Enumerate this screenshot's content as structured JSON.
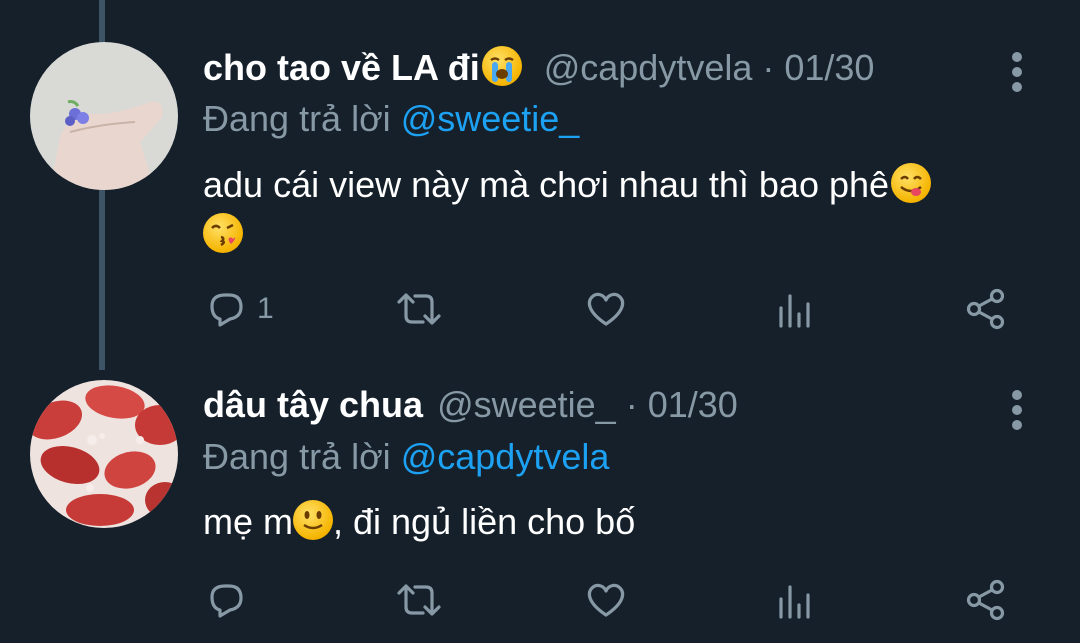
{
  "tweets": [
    {
      "name": "cho tao về LA đi",
      "name_emoji": "loudly-crying-face",
      "handle": "@capdytvela · 01/30",
      "reply_prefix": "Đang trả lời",
      "reply_mention": "@sweetie_",
      "text": "adu cái view này mà chơi nhau thì bao phê",
      "text_emojis": [
        "face-savoring-food",
        "face-blowing-kiss"
      ],
      "reply_count": "1"
    },
    {
      "name": "dâu tây chua",
      "handle": "@sweetie_ · 01/30",
      "reply_prefix": "Đang trả lời",
      "reply_mention": "@capdytvela",
      "text_before": "mẹ m",
      "text_emoji": "slightly-smiling-face",
      "text_after": ", đi ngủ liền cho bố",
      "reply_count": ""
    }
  ],
  "colors": {
    "background": "#15202b",
    "secondary_text": "#8899a6",
    "mention": "#1da1f2",
    "thread_line": "#3d5466"
  }
}
